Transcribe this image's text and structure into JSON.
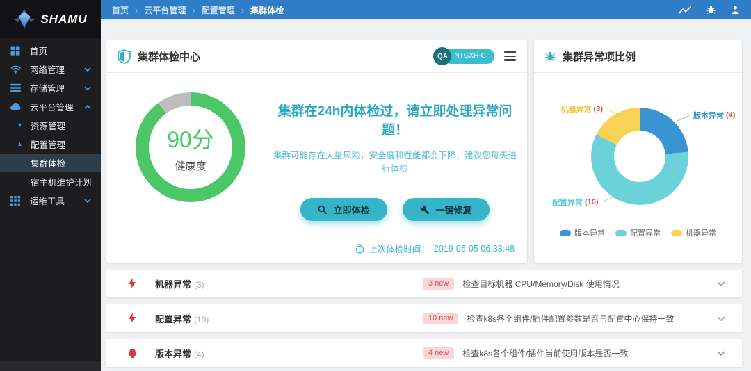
{
  "brand": {
    "name": "SHAMU"
  },
  "topbar": {
    "separator": "›",
    "breadcrumb": [
      {
        "label": "首页"
      },
      {
        "label": "云平台管理"
      },
      {
        "label": "配置管理"
      },
      {
        "label": "集群体检"
      }
    ],
    "icons": [
      "trend-icon",
      "bug-icon",
      "user-icon"
    ]
  },
  "sidebar": {
    "items": [
      {
        "label": "首页"
      },
      {
        "label": "网络管理",
        "expandable": true
      },
      {
        "label": "存储管理",
        "expandable": true
      },
      {
        "label": "云平台管理",
        "expanded": true
      },
      {
        "label": "资源管理"
      },
      {
        "label": "配置管理",
        "expanded": true
      },
      {
        "label": "集群体检",
        "selected": true
      },
      {
        "label": "宿主机维护计划"
      },
      {
        "label": "运维工具",
        "expandable": true
      }
    ]
  },
  "health_card": {
    "title": "集群体检中心",
    "env_badge": "QA",
    "cluster_name": "NTGXH-C",
    "score_text": "90分",
    "score_label": "健康度",
    "headline": "集群在24h内体检过，请立即处理异常问题！",
    "subline": "集群可能存在大量风险，安全度和性能都会下降，建议您每天进行体检",
    "check_button": "立即体检",
    "repair_button": "一键修复",
    "last_check_label": "上次体检时间：",
    "last_check_time": "2019-05-05 06:33:48"
  },
  "pie_card": {
    "title": "集群异常项比例",
    "labels": [
      {
        "name": "机器异常",
        "count": "(3)",
        "color": "#f0c23e"
      },
      {
        "name": "版本异常",
        "count": "(4)",
        "color": "#3a93d2"
      },
      {
        "name": "配置异常",
        "count": "(10)",
        "color": "#5fcbd6"
      }
    ],
    "legend": [
      {
        "label": "版本异常",
        "color": "#3a93d2"
      },
      {
        "label": "配置异常",
        "color": "#6bd2da"
      },
      {
        "label": "机器异常",
        "color": "#f7d254"
      }
    ]
  },
  "issues": [
    {
      "title": "机器异常",
      "count": "(3)",
      "badge": "3 new",
      "desc": "检查目标机器 CPU/Memory/Disk 使用情况",
      "icon": "lightning-icon"
    },
    {
      "title": "配置异常",
      "count": "(10)",
      "badge": "10 new",
      "desc": "检查k8s各个组件/插件配置参数是否与配置中心保持一致",
      "icon": "lightning-icon"
    },
    {
      "title": "版本异常",
      "count": "(4)",
      "badge": "4 new",
      "desc": "检查k8s各个组件/插件当前使用版本是否一致",
      "icon": "bell-icon"
    }
  ],
  "chart_data": [
    {
      "type": "donut-gauge",
      "title": "健康度",
      "value": 90,
      "max": 100,
      "center_text": "90分",
      "value_color": "#4bc768",
      "rest_color": "#bdbdbd",
      "start": "top, clockwise"
    },
    {
      "type": "pie",
      "title": "集群异常项比例",
      "categories": [
        "版本异常",
        "配置异常",
        "机器异常"
      ],
      "values": [
        4,
        10,
        3
      ],
      "colors": [
        "#3a93d2",
        "#6bd2da",
        "#f7d254"
      ],
      "donut": true,
      "start_angle": "top, clockwise",
      "legend_position": "bottom"
    }
  ],
  "colors": {
    "topbar_blue": "#2e7dc6",
    "sidebar_dark": "#1d1d20",
    "accent_teal": "#36b4c8",
    "gauge_green": "#4bc768",
    "alert_red": "#e03434",
    "badge_pink_bg": "#f8d7dc",
    "badge_pink_text": "#d9534f"
  }
}
